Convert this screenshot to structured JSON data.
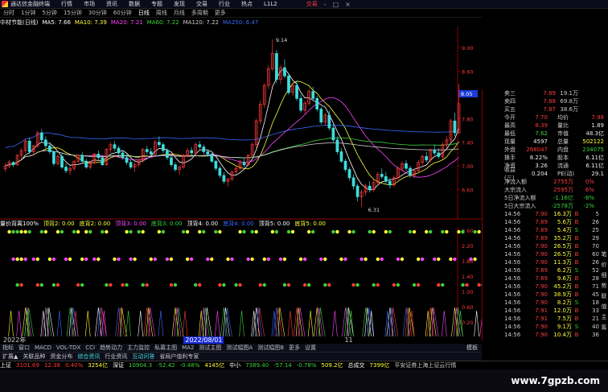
{
  "titlebar": {
    "app_name": "通达信金融终端",
    "menus": [
      "行情",
      "市场",
      "资讯",
      "数据",
      "专题",
      "发现",
      "交易",
      "行业",
      "热点",
      "L1L2"
    ],
    "trade_label": "交易",
    "win_controls": [
      "-",
      "□",
      "×"
    ]
  },
  "periods": [
    "分时",
    "1分钟",
    "5分钟",
    "15分钟",
    "30分钟",
    "60分钟",
    "日线",
    "周线",
    "月线",
    "多周期",
    "更多"
  ],
  "active_period": "日线",
  "ma_line": {
    "name": "中材节能(日线)",
    "items": [
      {
        "label": "MA5: 7.66",
        "color": "#ffffff"
      },
      {
        "label": "MA10: 7.39",
        "color": "#ffff3a"
      },
      {
        "label": "MA20: 7.21",
        "color": "#ff44ff"
      },
      {
        "label": "MA60: 7.22",
        "color": "#3cd33c"
      },
      {
        "label": "MA120: 7.22",
        "color": "#cccccc"
      },
      {
        "label": "MA250: 6.47",
        "color": "#3a6bff"
      }
    ]
  },
  "chart_data": {
    "type": "candlestick",
    "price_axis": {
      "ylim": [
        6.2,
        9.3
      ],
      "ticks": [
        "9.00",
        "8.60",
        "8.20",
        "7.80",
        "7.40",
        "7.00",
        "6.60"
      ]
    },
    "current_price_label": "8.05",
    "annotations": [
      {
        "text": "9.14",
        "kind": "high"
      },
      {
        "text": "6.31",
        "kind": "low"
      }
    ],
    "candles": [
      [
        6.95,
        7.05,
        6.9,
        7.0
      ],
      [
        7.0,
        7.1,
        6.96,
        7.06
      ],
      [
        7.06,
        7.08,
        6.98,
        7.02
      ],
      [
        7.02,
        7.2,
        7.0,
        7.18
      ],
      [
        7.18,
        7.3,
        7.12,
        7.26
      ],
      [
        7.26,
        7.45,
        7.22,
        7.42
      ],
      [
        7.42,
        7.48,
        7.2,
        7.24
      ],
      [
        7.24,
        7.36,
        7.18,
        7.34
      ],
      [
        7.34,
        7.6,
        7.3,
        7.56
      ],
      [
        7.56,
        7.62,
        7.4,
        7.44
      ],
      [
        7.44,
        7.5,
        7.3,
        7.34
      ],
      [
        7.34,
        7.4,
        7.2,
        7.24
      ],
      [
        7.24,
        7.26,
        7.0,
        7.04
      ],
      [
        7.04,
        7.2,
        7.0,
        7.16
      ],
      [
        7.16,
        7.22,
        6.95,
        6.98
      ],
      [
        6.98,
        7.04,
        6.88,
        6.92
      ],
      [
        6.92,
        7.0,
        6.85,
        6.96
      ],
      [
        6.96,
        7.1,
        6.92,
        7.08
      ],
      [
        7.08,
        7.2,
        7.04,
        7.18
      ],
      [
        7.18,
        7.24,
        7.05,
        7.08
      ],
      [
        7.08,
        7.12,
        6.95,
        6.98
      ],
      [
        6.98,
        7.08,
        6.94,
        7.06
      ],
      [
        7.06,
        7.22,
        7.02,
        7.2
      ],
      [
        7.2,
        7.26,
        7.1,
        7.14
      ],
      [
        7.14,
        7.18,
        7.0,
        7.02
      ],
      [
        7.02,
        7.3,
        7.0,
        7.28
      ],
      [
        7.28,
        7.4,
        7.22,
        7.36
      ],
      [
        7.36,
        7.42,
        7.25,
        7.3
      ],
      [
        7.3,
        7.34,
        7.18,
        7.22
      ],
      [
        7.22,
        7.26,
        7.1,
        7.14
      ],
      [
        7.14,
        7.2,
        7.02,
        7.06
      ],
      [
        7.06,
        7.1,
        6.95,
        6.98
      ],
      [
        6.98,
        7.06,
        6.9,
        7.02
      ],
      [
        7.02,
        7.12,
        6.98,
        7.1
      ],
      [
        7.1,
        7.3,
        7.06,
        7.28
      ],
      [
        7.28,
        7.34,
        7.2,
        7.24
      ],
      [
        7.24,
        7.3,
        7.16,
        7.2
      ],
      [
        7.2,
        7.44,
        7.18,
        7.4
      ],
      [
        7.4,
        7.5,
        7.32,
        7.36
      ],
      [
        7.36,
        7.4,
        7.22,
        7.26
      ],
      [
        7.26,
        7.3,
        7.1,
        7.14
      ],
      [
        7.14,
        7.18,
        6.98,
        7.02
      ],
      [
        7.02,
        7.06,
        6.9,
        6.94
      ],
      [
        6.94,
        7.0,
        6.85,
        6.98
      ],
      [
        6.98,
        7.2,
        6.95,
        7.18
      ],
      [
        7.18,
        7.3,
        7.14,
        7.26
      ],
      [
        7.26,
        7.32,
        7.18,
        7.22
      ],
      [
        7.22,
        7.4,
        7.2,
        7.36
      ],
      [
        7.36,
        7.42,
        7.28,
        7.32
      ],
      [
        7.32,
        7.36,
        7.2,
        7.24
      ],
      [
        7.24,
        7.28,
        7.15,
        7.2
      ],
      [
        7.2,
        7.22,
        7.05,
        7.08
      ],
      [
        7.08,
        7.1,
        6.92,
        6.96
      ],
      [
        6.96,
        7.0,
        6.8,
        6.84
      ],
      [
        6.84,
        6.9,
        6.7,
        6.74
      ],
      [
        6.74,
        6.8,
        6.65,
        6.78
      ],
      [
        6.78,
        6.92,
        6.74,
        6.9
      ],
      [
        6.9,
        7.0,
        6.86,
        6.96
      ],
      [
        6.96,
        7.1,
        6.92,
        7.06
      ],
      [
        7.06,
        7.14,
        6.98,
        7.02
      ],
      [
        7.02,
        7.2,
        7.0,
        7.18
      ],
      [
        7.18,
        7.4,
        7.14,
        7.36
      ],
      [
        7.36,
        7.8,
        7.3,
        7.76
      ],
      [
        7.76,
        8.1,
        7.7,
        8.04
      ],
      [
        8.04,
        8.4,
        7.98,
        8.36
      ],
      [
        8.36,
        8.7,
        8.3,
        8.64
      ],
      [
        8.64,
        9.14,
        8.6,
        8.9
      ],
      [
        8.9,
        8.96,
        8.4,
        8.46
      ],
      [
        8.46,
        8.7,
        8.38,
        8.66
      ],
      [
        8.66,
        8.8,
        8.48,
        8.52
      ],
      [
        8.52,
        8.56,
        8.2,
        8.24
      ],
      [
        8.24,
        8.4,
        8.18,
        8.36
      ],
      [
        8.36,
        8.44,
        8.1,
        8.14
      ],
      [
        8.14,
        8.2,
        7.9,
        7.94
      ],
      [
        7.94,
        8.1,
        7.88,
        8.06
      ],
      [
        8.06,
        8.3,
        8.02,
        8.26
      ],
      [
        8.26,
        8.34,
        8.1,
        8.14
      ],
      [
        8.14,
        8.18,
        7.92,
        7.96
      ],
      [
        7.96,
        8.0,
        7.7,
        7.74
      ],
      [
        7.74,
        7.9,
        7.68,
        7.86
      ],
      [
        7.86,
        7.94,
        7.6,
        7.64
      ],
      [
        7.64,
        7.7,
        7.4,
        7.44
      ],
      [
        7.44,
        7.5,
        7.2,
        7.24
      ],
      [
        7.24,
        7.3,
        7.05,
        7.08
      ],
      [
        7.08,
        7.12,
        6.9,
        6.94
      ],
      [
        6.94,
        6.98,
        6.75,
        6.8
      ],
      [
        6.8,
        6.86,
        6.6,
        6.66
      ],
      [
        6.66,
        6.7,
        6.4,
        6.48
      ],
      [
        6.48,
        6.6,
        6.31,
        6.56
      ],
      [
        6.56,
        6.7,
        6.5,
        6.66
      ],
      [
        6.66,
        6.74,
        6.55,
        6.6
      ],
      [
        6.6,
        6.76,
        6.56,
        6.72
      ],
      [
        6.72,
        6.9,
        6.68,
        6.86
      ],
      [
        6.86,
        6.96,
        6.78,
        6.82
      ],
      [
        6.82,
        6.9,
        6.7,
        6.74
      ],
      [
        6.74,
        6.8,
        6.62,
        6.68
      ],
      [
        6.68,
        6.84,
        6.64,
        6.8
      ],
      [
        6.8,
        7.0,
        6.76,
        6.96
      ],
      [
        6.96,
        7.08,
        6.9,
        7.04
      ],
      [
        7.04,
        7.1,
        6.92,
        6.96
      ],
      [
        6.96,
        7.0,
        6.8,
        6.84
      ],
      [
        6.84,
        6.96,
        6.8,
        6.92
      ],
      [
        6.92,
        7.1,
        6.88,
        7.06
      ],
      [
        7.06,
        7.2,
        7.0,
        7.16
      ],
      [
        7.16,
        7.24,
        7.06,
        7.1
      ],
      [
        7.1,
        7.3,
        7.06,
        7.26
      ],
      [
        7.26,
        7.36,
        7.18,
        7.22
      ],
      [
        7.22,
        7.3,
        7.12,
        7.16
      ],
      [
        7.16,
        7.4,
        7.12,
        7.36
      ],
      [
        7.36,
        7.5,
        7.3,
        7.44
      ],
      [
        7.44,
        7.8,
        7.4,
        7.76
      ],
      [
        7.76,
        7.9,
        7.5,
        7.56
      ],
      [
        7.56,
        8.39,
        7.54,
        8.05
      ]
    ]
  },
  "indicator_line": {
    "items": [
      {
        "label": "量价背离100%",
        "color": "#ffffff"
      },
      {
        "label": "顶背2: 0.00",
        "color": "#ffff3a"
      },
      {
        "label": "底背2: 0.00",
        "color": "#ffff3a"
      },
      {
        "label": "顶背3: 0.00",
        "color": "#ff44ff"
      },
      {
        "label": "底背3: 0.00",
        "color": "#3cd33c"
      },
      {
        "label": "顶背4: 0.00",
        "color": "#ffffff"
      },
      {
        "label": "底背4: 0.00",
        "color": "#3a6bff"
      },
      {
        "label": "顶背5: 0.00",
        "color": "#ffffff"
      },
      {
        "label": "底背5: 0.00",
        "color": "#ffff3a"
      }
    ],
    "axis_ticks": [
      "2.60",
      "2.20",
      "1.80",
      "1.40",
      "1.00",
      "0.60",
      "0.20"
    ],
    "series": [
      {
        "marks": [
          1,
          3,
          5,
          9,
          13,
          17,
          20,
          24,
          30,
          33,
          38,
          44,
          48,
          52,
          58,
          61,
          66,
          70,
          75,
          81,
          85,
          90,
          94,
          100,
          104,
          108,
          112,
          116
        ]
      },
      {
        "marks": [
          2,
          4,
          7,
          11,
          15,
          19,
          22,
          27,
          31,
          36,
          40,
          45,
          50,
          55,
          60,
          64,
          68,
          73,
          78,
          83,
          88,
          92,
          97,
          102,
          106,
          110,
          115
        ]
      },
      {
        "marks": [
          3,
          8,
          12,
          18,
          25,
          29,
          34,
          41,
          47,
          53,
          57,
          63,
          69,
          74,
          79,
          86,
          91,
          96,
          101,
          107,
          113,
          117
        ]
      },
      {
        "marks": [
          5,
          10,
          16,
          23,
          28,
          35,
          42,
          49,
          54,
          62,
          67,
          72,
          77,
          84,
          89,
          95,
          99,
          105,
          111,
          118
        ]
      }
    ]
  },
  "quote_panel": {
    "asks": [
      {
        "label": "卖三",
        "price": "7.89",
        "vol": "19.1万"
      },
      {
        "label": "卖四",
        "price": "7.88",
        "vol": "69.8万"
      },
      {
        "label": "买五",
        "price": "7.87",
        "vol": "38.6万"
      }
    ],
    "stats": [
      {
        "l": "今开",
        "v": "7.70",
        "vc": "red",
        "l2": "均价",
        "v2": "7.98",
        "v2c": "red"
      },
      {
        "l": "最高",
        "v": "8.39",
        "vc": "red",
        "l2": "量比",
        "v2": "1.89",
        "v2c": "white"
      },
      {
        "l": "最低",
        "v": "7.62",
        "vc": "green",
        "l2": "市值",
        "v2": "48.3亿",
        "v2c": "white"
      },
      {
        "l": "现量",
        "v": "4597",
        "vc": "white",
        "l2": "总量",
        "v2": "502122",
        "v2c": "yellow"
      },
      {
        "l": "外盘",
        "v": "268047",
        "vc": "red",
        "l2": "内盘",
        "v2": "234075",
        "v2c": "green"
      },
      {
        "l": "换手",
        "v": "8.22%",
        "vc": "white",
        "l2": "股本",
        "v2": "6.11亿",
        "v2c": "white"
      },
      {
        "l": "净资",
        "v": "3.26",
        "vc": "white",
        "l2": "流通",
        "v2": "6.11亿",
        "v2c": "white"
      },
      {
        "l": "收益(三)",
        "v": "0.204",
        "vc": "white",
        "l2": "PE(动)",
        "v2": "29.1",
        "v2c": "white"
      }
    ],
    "flows": [
      {
        "l": "净流入额",
        "v": "2755万",
        "vc": "red",
        "v2": "0%",
        "v2c": "red"
      },
      {
        "l": "大宗流入",
        "v": "2595万",
        "vc": "red",
        "v2": "6%",
        "v2c": "red"
      },
      {
        "l": "5日净流入额",
        "v": "-1.16亿",
        "vc": "green",
        "v2": "-8%",
        "v2c": "green"
      },
      {
        "l": "5日大宗流入",
        "v": "-2578万",
        "vc": "green",
        "v2": "-2%",
        "v2c": "green"
      }
    ],
    "ticks": [
      {
        "t": "14:56",
        "p": "7.90",
        "q": "16.3万",
        "d": "B",
        "dc": "red",
        "n": "5"
      },
      {
        "t": "14:56",
        "p": "7.89",
        "q": "5.6万",
        "d": "B",
        "dc": "red",
        "n": "26"
      },
      {
        "t": "14:56",
        "p": "7.89",
        "q": "5.4万",
        "d": "S",
        "dc": "green",
        "n": "25"
      },
      {
        "t": "14:56",
        "p": "7.89",
        "q": "35.2万",
        "d": "B",
        "dc": "red",
        "n": "29"
      },
      {
        "t": "14:56",
        "p": "7.90",
        "q": "26.5万",
        "d": "B",
        "dc": "red",
        "n": "70"
      },
      {
        "t": "14:56",
        "p": "7.90",
        "q": "26.5万",
        "d": "B",
        "dc": "red",
        "n": "60"
      },
      {
        "t": "14:56",
        "p": "7.90",
        "q": "11.3万",
        "d": "B",
        "dc": "red",
        "n": "26"
      },
      {
        "t": "14:56",
        "p": "7.89",
        "q": "6.2万",
        "d": "S",
        "dc": "green",
        "n": "52"
      },
      {
        "t": "14:56",
        "p": "7.89",
        "q": "9.6万",
        "d": "B",
        "dc": "red",
        "n": "28"
      },
      {
        "t": "14:56",
        "p": "7.90",
        "q": "45.2万",
        "d": "B",
        "dc": "red",
        "n": "71"
      },
      {
        "t": "14:56",
        "p": "7.90",
        "q": "38.9万",
        "d": "B",
        "dc": "red",
        "n": "45"
      },
      {
        "t": "14:56",
        "p": "7.90",
        "q": "8.2万",
        "d": "S",
        "dc": "green",
        "n": "18"
      },
      {
        "t": "14:56",
        "p": "7.91",
        "q": "12.0万",
        "d": "B",
        "dc": "red",
        "n": "33"
      },
      {
        "t": "14:56",
        "p": "7.91",
        "q": "7.5万",
        "d": "B",
        "dc": "red",
        "n": "21"
      },
      {
        "t": "14:56",
        "p": "7.90",
        "q": "9.1万",
        "d": "S",
        "dc": "green",
        "n": "40"
      },
      {
        "t": "14:56",
        "p": "7.90",
        "q": "10.4万",
        "d": "B",
        "dc": "red",
        "n": "36"
      }
    ],
    "side_tabs": [
      "笔",
      "价",
      "细",
      "势",
      "联",
      "值",
      "主",
      "筹"
    ]
  },
  "time_axis": {
    "labels": [
      "2022年",
      "2022/08/01",
      "11"
    ]
  },
  "indicator_tabs": [
    "指标",
    "窗口",
    "MACD",
    "VOL-TDX",
    "CCI",
    "趋势动力",
    "主力监控",
    "私募主图",
    "MA2",
    "测试主图",
    "测试幅图A",
    "测试幅图B",
    "更多",
    "设置"
  ],
  "tab_right_label": "模板",
  "ext_bar": [
    {
      "label": "扩展▲",
      "color": "#cccccc"
    },
    {
      "label": "关联品种",
      "color": "#cccccc"
    },
    {
      "label": "资金分布",
      "color": "#cccccc"
    },
    {
      "label": "综合资讯",
      "color": "#3fdcdc"
    },
    {
      "label": "行业资讯",
      "color": "#cccccc"
    },
    {
      "label": "互动问答",
      "color": "#3fdcdc"
    },
    {
      "label": "省局户值利专家",
      "color": "#cccccc"
    }
  ],
  "status_bar": [
    {
      "label": "上证",
      "color": "#ffffff"
    },
    {
      "label": "3101.69",
      "color": "#ff3b3b"
    },
    {
      "label": "12.38",
      "color": "#ff3b3b"
    },
    {
      "label": "0.40%",
      "color": "#ff3b3b"
    },
    {
      "label": "3254亿",
      "color": "#ffff3a"
    },
    {
      "label": "深证",
      "color": "#ffffff"
    },
    {
      "label": "10904.3",
      "color": "#3cd33c"
    },
    {
      "label": "-52.42",
      "color": "#3cd33c"
    },
    {
      "label": "-0.48%",
      "color": "#3cd33c"
    },
    {
      "label": "4145亿",
      "color": "#ffff3a"
    },
    {
      "label": "中小",
      "color": "#ffffff"
    },
    {
      "label": "7389.40",
      "color": "#3cd33c"
    },
    {
      "label": "-57.14",
      "color": "#3cd33c"
    },
    {
      "label": "-0.78%",
      "color": "#3cd33c"
    },
    {
      "label": "509.2亿",
      "color": "#ffff3a"
    },
    {
      "label": "总成交",
      "color": "#ffffff"
    },
    {
      "label": "7399亿",
      "color": "#ffff3a"
    },
    {
      "label": "平安证券上海上证云行情",
      "color": "#cccccc"
    }
  ],
  "watermark": "www.7gpzb.com"
}
